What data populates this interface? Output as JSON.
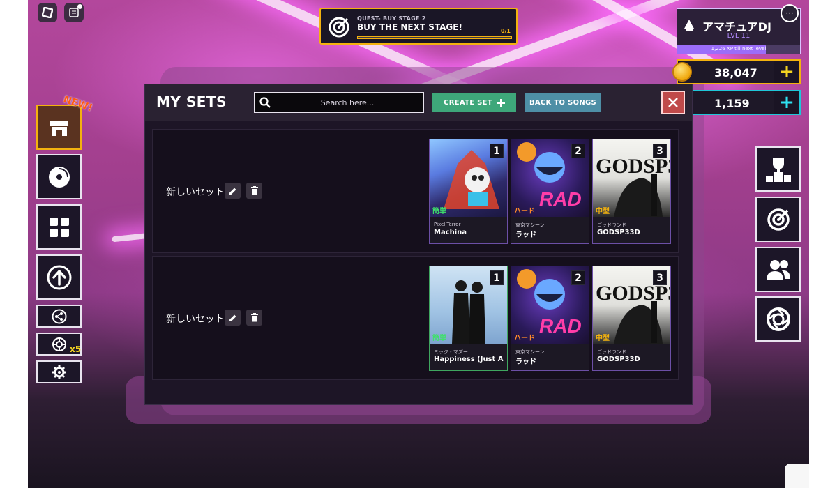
{
  "quest": {
    "label": "QUEST- BUY STAGE 2",
    "title": "BUY THE NEXT STAGE!",
    "progress_text": "0/1",
    "progress": 0
  },
  "profile": {
    "name": "アマチュアDJ",
    "level": "LVL 11",
    "xp_text": "1,226 XP till next level",
    "xp_fraction": 0.72,
    "menu_icon": "ellipsis-icon"
  },
  "currencies": {
    "coins": {
      "value": "38,047",
      "plus": "+",
      "accent": "#f3b20f"
    },
    "gems": {
      "value": "1,159",
      "plus": "+",
      "accent": "#1fc6d8"
    }
  },
  "left_menu": {
    "new_badge": "NEW!",
    "multiplier": "x5",
    "items": [
      "store-icon",
      "record-icon",
      "grid-icon",
      "upgrade-arrow-icon",
      "share-icon",
      "spinner-icon",
      "gear-icon"
    ]
  },
  "right_menu": {
    "items": [
      "trophy-icon",
      "target-icon",
      "friends-icon",
      "camera-lens-icon"
    ]
  },
  "panel": {
    "title": "MY SETS",
    "search_placeholder": "Search here...",
    "create_label": "CREATE SET",
    "back_label": "BACK TO SONGS",
    "close_icon": "close-icon"
  },
  "sets": [
    {
      "name": "新しいセット",
      "cards": [
        {
          "slot": "1",
          "difficulty": "簡単",
          "diff_color": "#3fe06b",
          "artist": "Pixel Terror",
          "title": "Machina"
        },
        {
          "slot": "2",
          "difficulty": "ハード",
          "diff_color": "#ff8a2a",
          "artist": "東京マシーン",
          "title": "ラッド"
        },
        {
          "slot": "3",
          "difficulty": "中型",
          "diff_color": "#f3b20f",
          "artist": "ゴッドランド",
          "title": "GODSP33D"
        }
      ]
    },
    {
      "name": "新しいセット",
      "cards": [
        {
          "slot": "1",
          "difficulty": "簡単",
          "diff_color": "#3fe06b",
          "artist": "ミック・マズー",
          "title": "Happiness (Just A"
        },
        {
          "slot": "2",
          "difficulty": "ハード",
          "diff_color": "#ff8a2a",
          "artist": "東京マシーン",
          "title": "ラッド"
        },
        {
          "slot": "3",
          "difficulty": "中型",
          "diff_color": "#f3b20f",
          "artist": "ゴッドランド",
          "title": "GODSP33D"
        }
      ]
    }
  ]
}
